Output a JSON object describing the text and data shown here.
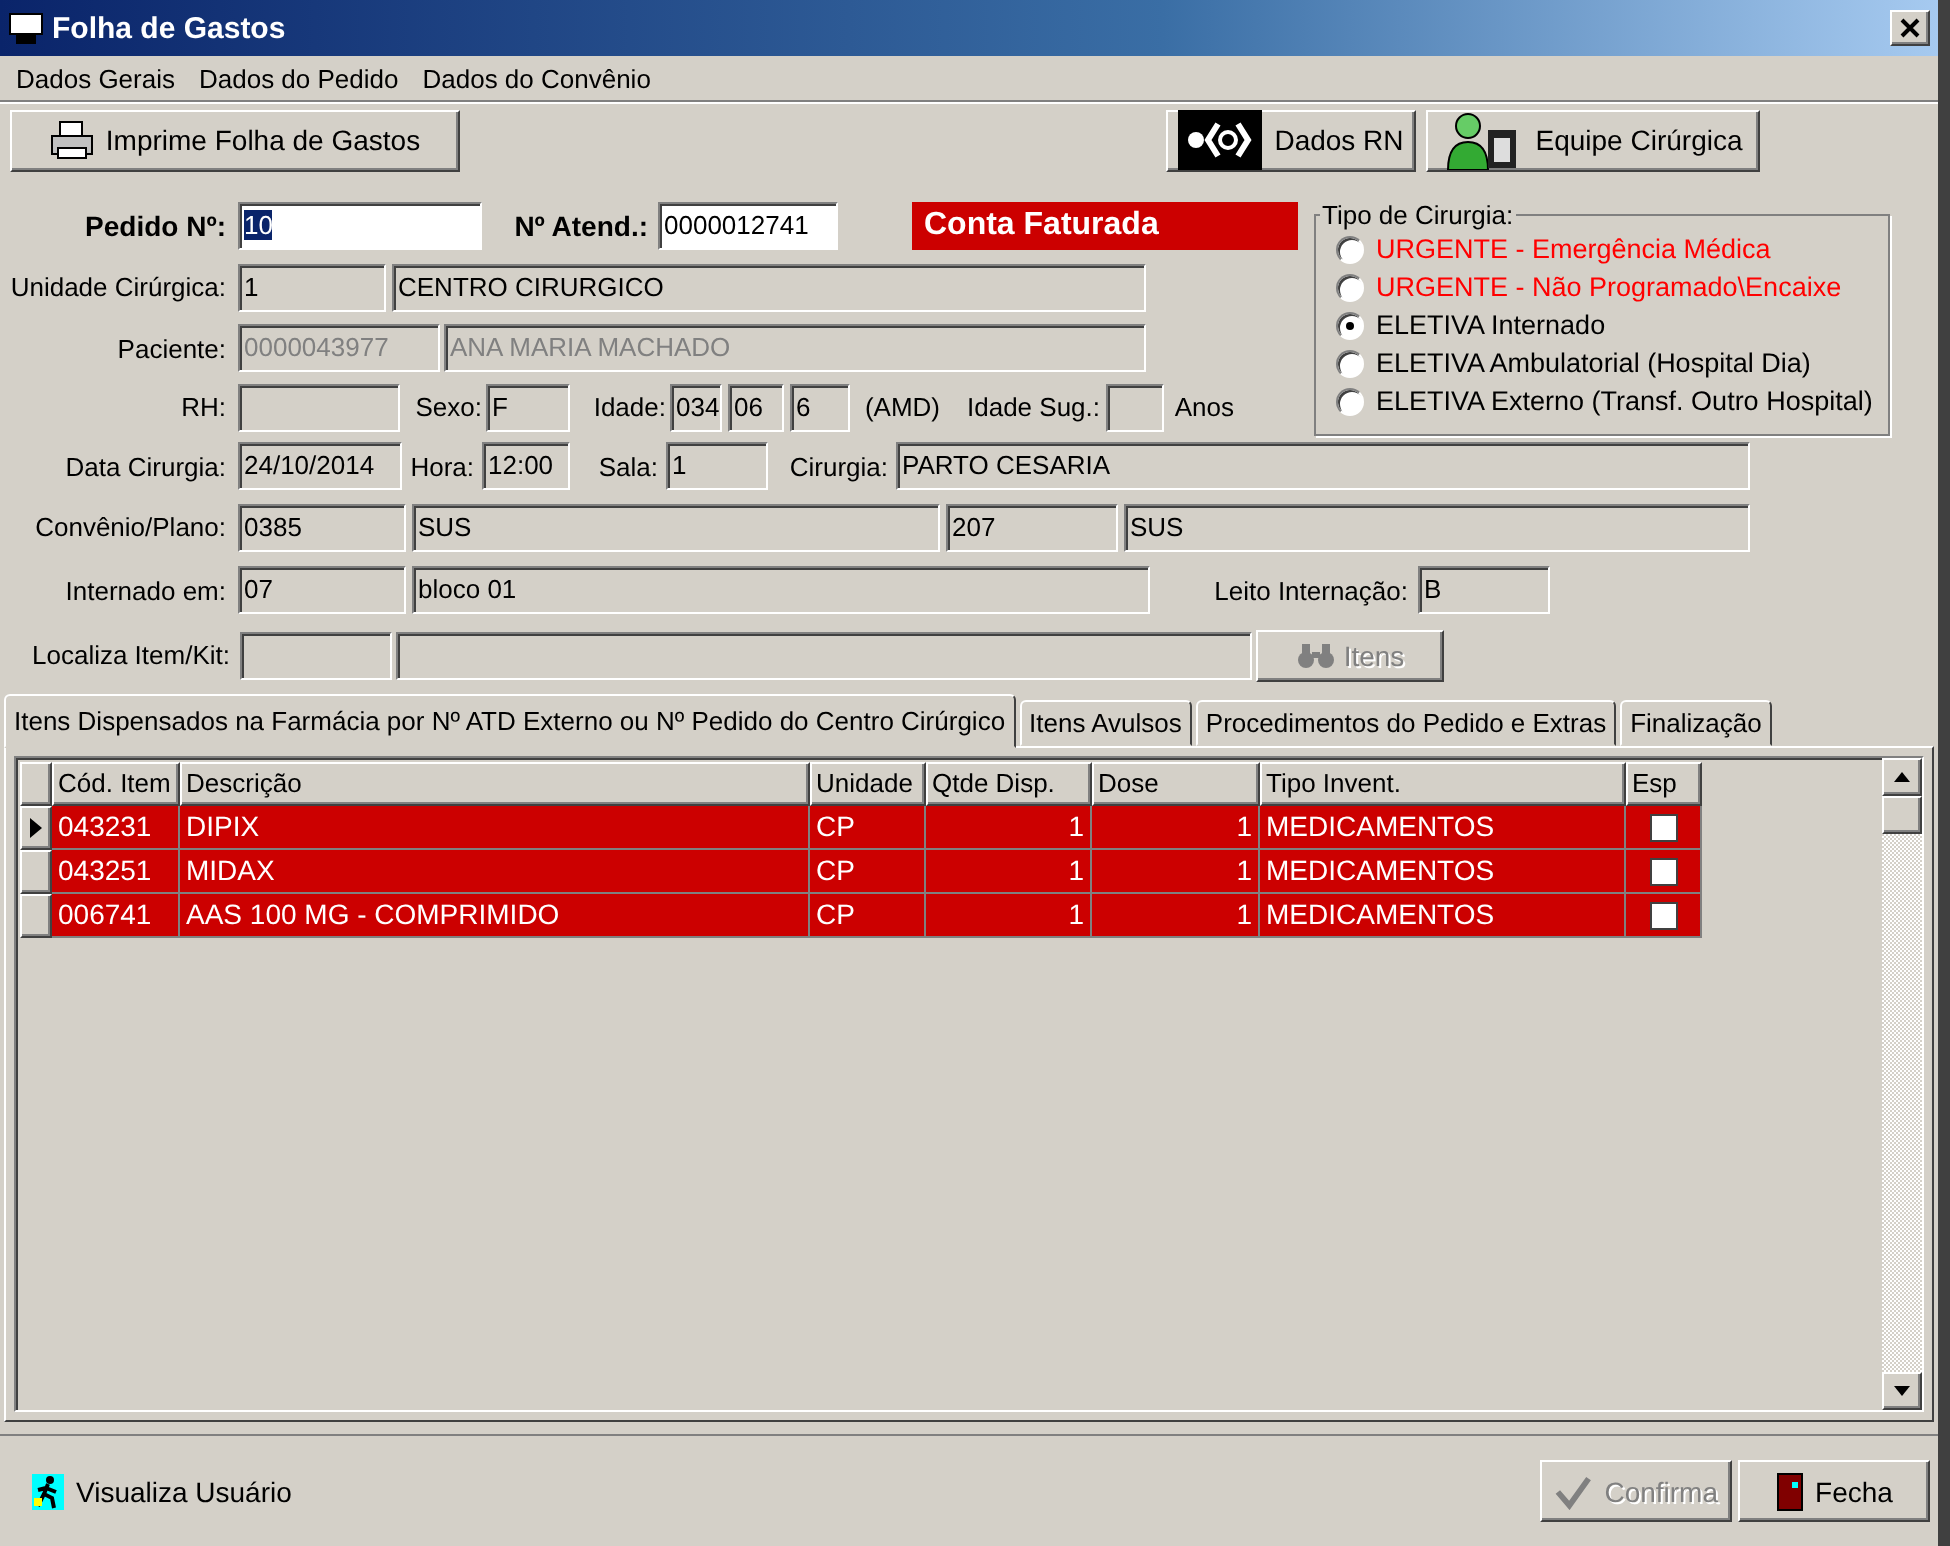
{
  "window": {
    "title": "Folha de Gastos"
  },
  "menu": [
    "Dados Gerais",
    "Dados do Pedido",
    "Dados do Convênio"
  ],
  "toolbar": [
    {
      "kind": "print",
      "label": "Imprime Folha de Gastos"
    },
    {
      "kind": "newborn",
      "label": "Dados RN"
    },
    {
      "kind": "team",
      "label": "Equipe Cirúrgica"
    }
  ],
  "form": {
    "rows": [
      {
        "items": [
          {
            "kind": "label",
            "text": "Pedido Nº:",
            "bold": true
          },
          {
            "kind": "input",
            "value": "10",
            "focused": true
          },
          {
            "kind": "label",
            "text": "Nº Atend.:",
            "bold": true
          },
          {
            "kind": "input",
            "value": "0000012741",
            "focused": false
          },
          {
            "kind": "status",
            "text": "Conta Faturada"
          }
        ]
      },
      {
        "items": [
          {
            "kind": "label",
            "text": "Unidade Cirúrgica:",
            "bold": false
          },
          {
            "kind": "field",
            "value": "1",
            "disabled": false
          },
          {
            "kind": "field",
            "value": "CENTRO CIRURGICO",
            "disabled": false
          }
        ]
      },
      {
        "items": [
          {
            "kind": "label",
            "text": "Paciente:",
            "bold": false
          },
          {
            "kind": "field",
            "value": "0000043977",
            "disabled": true
          },
          {
            "kind": "field",
            "value": "ANA MARIA MACHADO",
            "disabled": true
          }
        ]
      },
      {
        "items": [
          {
            "kind": "label",
            "text": "RH:",
            "bold": false
          },
          {
            "kind": "field"
          },
          {
            "kind": "label",
            "text": "Sexo:",
            "bold": false
          },
          {
            "kind": "field",
            "value": "F",
            "disabled": false
          },
          {
            "kind": "label",
            "text": "Idade:",
            "bold": false
          },
          {
            "kind": "field",
            "value": "034",
            "disabled": false
          },
          {
            "kind": "field",
            "value": "06",
            "disabled": false
          },
          {
            "kind": "field",
            "value": "6",
            "disabled": false
          },
          {
            "kind": "label",
            "text": "(AMD)",
            "bold": false
          },
          {
            "kind": "label",
            "text": "Idade Sug.:",
            "bold": false
          },
          {
            "kind": "field"
          },
          {
            "kind": "label",
            "text": "Anos",
            "bold": false
          }
        ]
      },
      {
        "items": [
          {
            "kind": "label",
            "text": "Data Cirurgia:",
            "bold": false
          },
          {
            "kind": "field",
            "value": "24/10/2014",
            "disabled": false
          },
          {
            "kind": "label",
            "text": "Hora:",
            "bold": false
          },
          {
            "kind": "field",
            "value": "12:00",
            "disabled": false
          },
          {
            "kind": "label",
            "text": "Sala:",
            "bold": false
          },
          {
            "kind": "field",
            "value": "1",
            "disabled": false
          },
          {
            "kind": "label",
            "text": "Cirurgia:",
            "bold": false
          },
          {
            "kind": "field",
            "value": "PARTO CESARIA",
            "disabled": false
          }
        ]
      },
      {
        "items": [
          {
            "kind": "label",
            "text": "Convênio/Plano:",
            "bold": false
          },
          {
            "kind": "field",
            "value": "0385",
            "disabled": false
          },
          {
            "kind": "field",
            "value": "SUS",
            "disabled": false
          },
          {
            "kind": "field",
            "value": "207",
            "disabled": false
          },
          {
            "kind": "field",
            "value": "SUS",
            "disabled": false
          }
        ]
      },
      {
        "items": [
          {
            "kind": "label",
            "text": "Internado em:",
            "bold": false
          },
          {
            "kind": "field",
            "value": "07",
            "disabled": false
          },
          {
            "kind": "field",
            "value": "bloco 01",
            "disabled": false
          },
          {
            "kind": "label",
            "text": "Leito Internação:",
            "bold": false
          },
          {
            "kind": "field",
            "value": "B",
            "disabled": false
          }
        ]
      },
      {
        "items": [
          {
            "kind": "label",
            "text": "Localiza Item/Kit:",
            "bold": false
          },
          {
            "kind": "field"
          },
          {
            "kind": "field"
          },
          {
            "kind": "button",
            "text": "Itens",
            "disabled": true
          }
        ]
      }
    ]
  },
  "surgery_type": {
    "title": "Tipo de Cirurgia:",
    "options": [
      {
        "label": "URGENTE - Emergência Médica",
        "selected": false,
        "color": "#ff0000"
      },
      {
        "label": "URGENTE - Não Programado\\Encaixe",
        "selected": false,
        "color": "#ff0000"
      },
      {
        "label": "ELETIVA Internado",
        "selected": true,
        "color": "#000000"
      },
      {
        "label": "ELETIVA Ambulatorial (Hospital Dia)",
        "selected": false,
        "color": "#000000"
      },
      {
        "label": "ELETIVA Externo (Transf. Outro Hospital)",
        "selected": false,
        "color": "#000000"
      }
    ]
  },
  "tabs": [
    {
      "label": "Itens Dispensados na Farmácia por Nº ATD Externo ou Nº Pedido do Centro Cirúrgico",
      "selected": true
    },
    {
      "label": "Itens Avulsos",
      "selected": false
    },
    {
      "label": "Procedimentos do Pedido e  Extras",
      "selected": false
    },
    {
      "label": "Finalização",
      "selected": false
    }
  ],
  "table": {
    "columns": [
      "Cód. Item",
      "Descrição",
      "Unidade",
      "Qtde Disp.",
      "Dose",
      "Tipo Invent.",
      "Esp"
    ],
    "rows": [
      {
        "cells": [
          "043231",
          "DIPIX",
          "CP",
          "1",
          "1",
          "MEDICAMENTOS"
        ],
        "current": true,
        "checked": false
      },
      {
        "cells": [
          "043251",
          "MIDAX",
          "CP",
          "1",
          "1",
          "MEDICAMENTOS"
        ],
        "current": false,
        "checked": false
      },
      {
        "cells": [
          "006741",
          "AAS 100 MG - COMPRIMIDO",
          "CP",
          "1",
          "1",
          "MEDICAMENTOS"
        ],
        "current": false,
        "checked": false
      }
    ]
  },
  "footer": {
    "user_link": "Visualiza Usuário",
    "buttons": [
      {
        "kind": "confirm",
        "label": "Confirma",
        "disabled": true
      },
      {
        "kind": "close",
        "label": "Fecha",
        "disabled": false
      }
    ]
  }
}
